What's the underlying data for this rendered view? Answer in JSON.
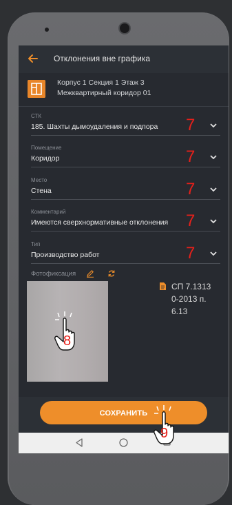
{
  "appbar": {
    "title": "Отклонения вне графика"
  },
  "header": {
    "line1": "Корпус 1 Секция 1 Этаж 3",
    "line2": "Межквартирный коридор 01"
  },
  "fields": [
    {
      "label": "СТК",
      "value": "185. Шахты дымоудаления и подпора",
      "marker": "7"
    },
    {
      "label": "Помещение",
      "value": "Коридор",
      "marker": "7"
    },
    {
      "label": "Место",
      "value": "Стена",
      "marker": "7"
    },
    {
      "label": "Комментарий",
      "value": "Имеются сверхнормативные отклонения",
      "marker": "7"
    },
    {
      "label": "Тип",
      "value": "Производство работ",
      "marker": "7"
    }
  ],
  "photo_section": {
    "label": "Фотофиксация"
  },
  "document": {
    "line1": "СП 7.1313",
    "line2": "0-2013 п.",
    "line3": "6.13"
  },
  "save_button": {
    "label": "СОХРАНИТЬ"
  },
  "annotations": {
    "photo_marker": "8",
    "save_marker": "9"
  },
  "colors": {
    "accent": "#ee8e2a",
    "background": "#272a30",
    "marker": "#e8201a"
  }
}
